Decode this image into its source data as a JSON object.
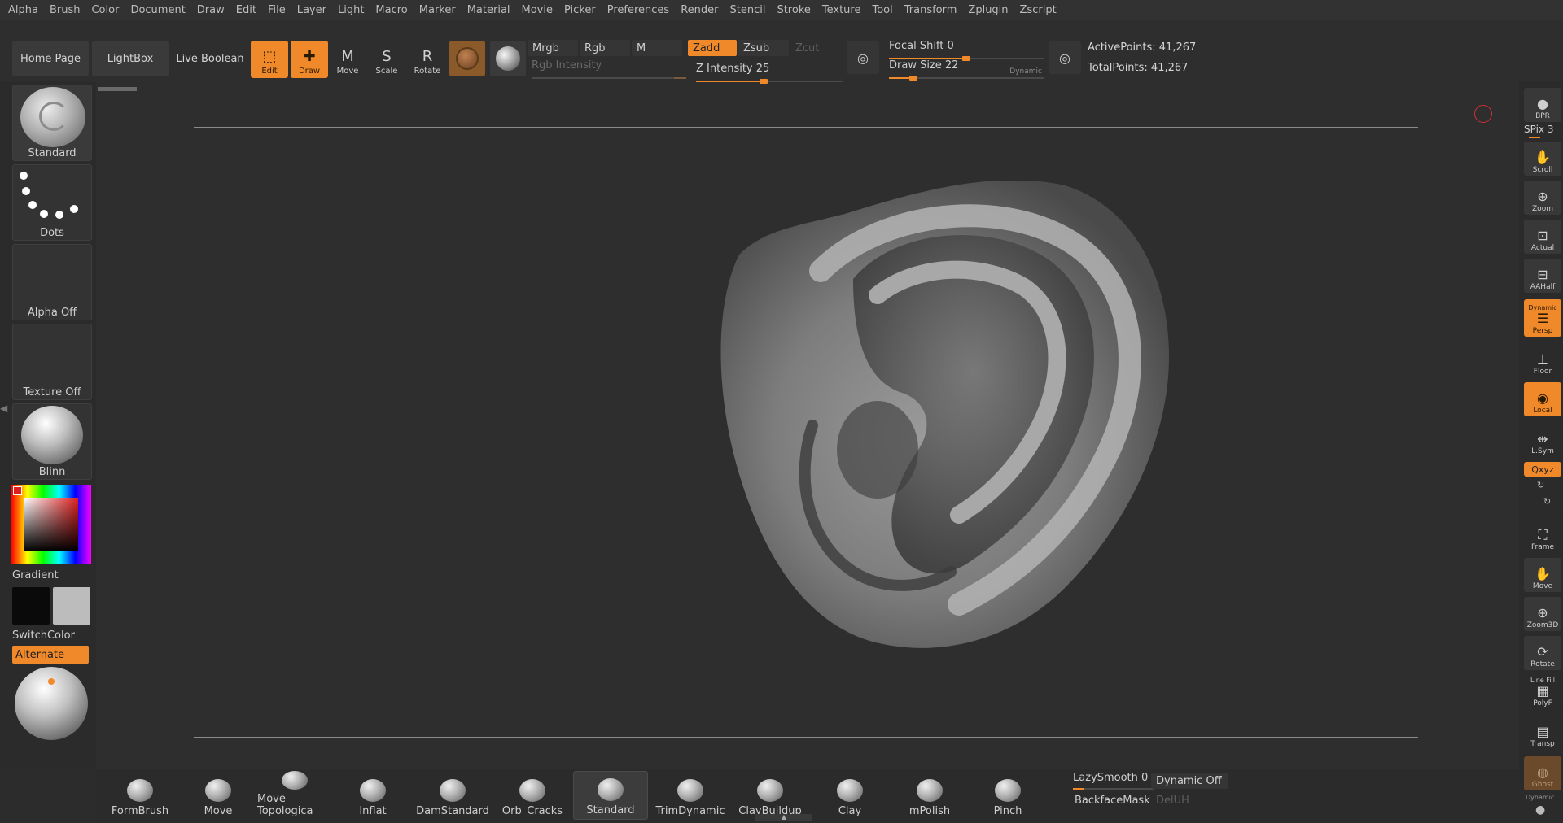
{
  "menu": [
    "Alpha",
    "Brush",
    "Color",
    "Document",
    "Draw",
    "Edit",
    "File",
    "Layer",
    "Light",
    "Macro",
    "Marker",
    "Material",
    "Movie",
    "Picker",
    "Preferences",
    "Render",
    "Stencil",
    "Stroke",
    "Texture",
    "Tool",
    "Transform",
    "Zplugin",
    "Zscript"
  ],
  "toolbar": {
    "home_page": "Home Page",
    "lightbox": "LightBox",
    "live_boolean": "Live Boolean",
    "edit": "Edit",
    "draw": "Draw",
    "move": "Move",
    "scale": "Scale",
    "rotate": "Rotate",
    "mrgb": "Mrgb",
    "rgb": "Rgb",
    "m": "M",
    "zadd": "Zadd",
    "zsub": "Zsub",
    "zcut": "Zcut",
    "rgb_intensity_label": "Rgb Intensity",
    "z_intensity_label": "Z Intensity 25",
    "z_intensity_value": 25,
    "focal_shift_label": "Focal Shift 0",
    "focal_shift_value": 0,
    "draw_size_label": "Draw Size 22",
    "draw_size_value": 22,
    "dynamic_label": "Dynamic",
    "active_points": "ActivePoints: 41,267",
    "total_points": "TotalPoints: 41,267"
  },
  "left_tray": {
    "brush": "Standard",
    "stroke": "Dots",
    "alpha": "Alpha Off",
    "texture": "Texture Off",
    "material": "Blinn",
    "gradient": "Gradient",
    "switch_color": "SwitchColor",
    "alternate": "Alternate"
  },
  "right_shelf": {
    "bpr": "BPR",
    "spix": "SPix 3",
    "scroll": "Scroll",
    "zoom": "Zoom",
    "actual": "Actual",
    "aahalf": "AAHalf",
    "persp_top": "Dynamic",
    "persp": "Persp",
    "floor": "Floor",
    "local": "Local",
    "lsym": "L.Sym",
    "xyz": "Qxyz",
    "frame": "Frame",
    "move": "Move",
    "zoom3d": "Zoom3D",
    "rotate": "Rotate",
    "line_fill": "Line Fill",
    "polyf": "PolyF",
    "transp": "Transp",
    "ghost": "Ghost",
    "dynamic_bottom": "Dynamic"
  },
  "bottom_shelf": {
    "brushes": [
      "FormBrush",
      "Move",
      "Move Topologica",
      "Inflat",
      "DamStandard",
      "Orb_Cracks",
      "Standard",
      "TrimDynamic",
      "ClayBuildup",
      "Clay",
      "mPolish",
      "Pinch"
    ],
    "selected": "Standard",
    "lazy_smooth": "LazySmooth 0",
    "dynamic_off": "Dynamic Off",
    "backface_mask": "BackfaceMask",
    "deluh": "DelUH"
  },
  "colors": {
    "accent": "#f0892a",
    "background": "#2e2e2e",
    "panel": "#383838"
  }
}
